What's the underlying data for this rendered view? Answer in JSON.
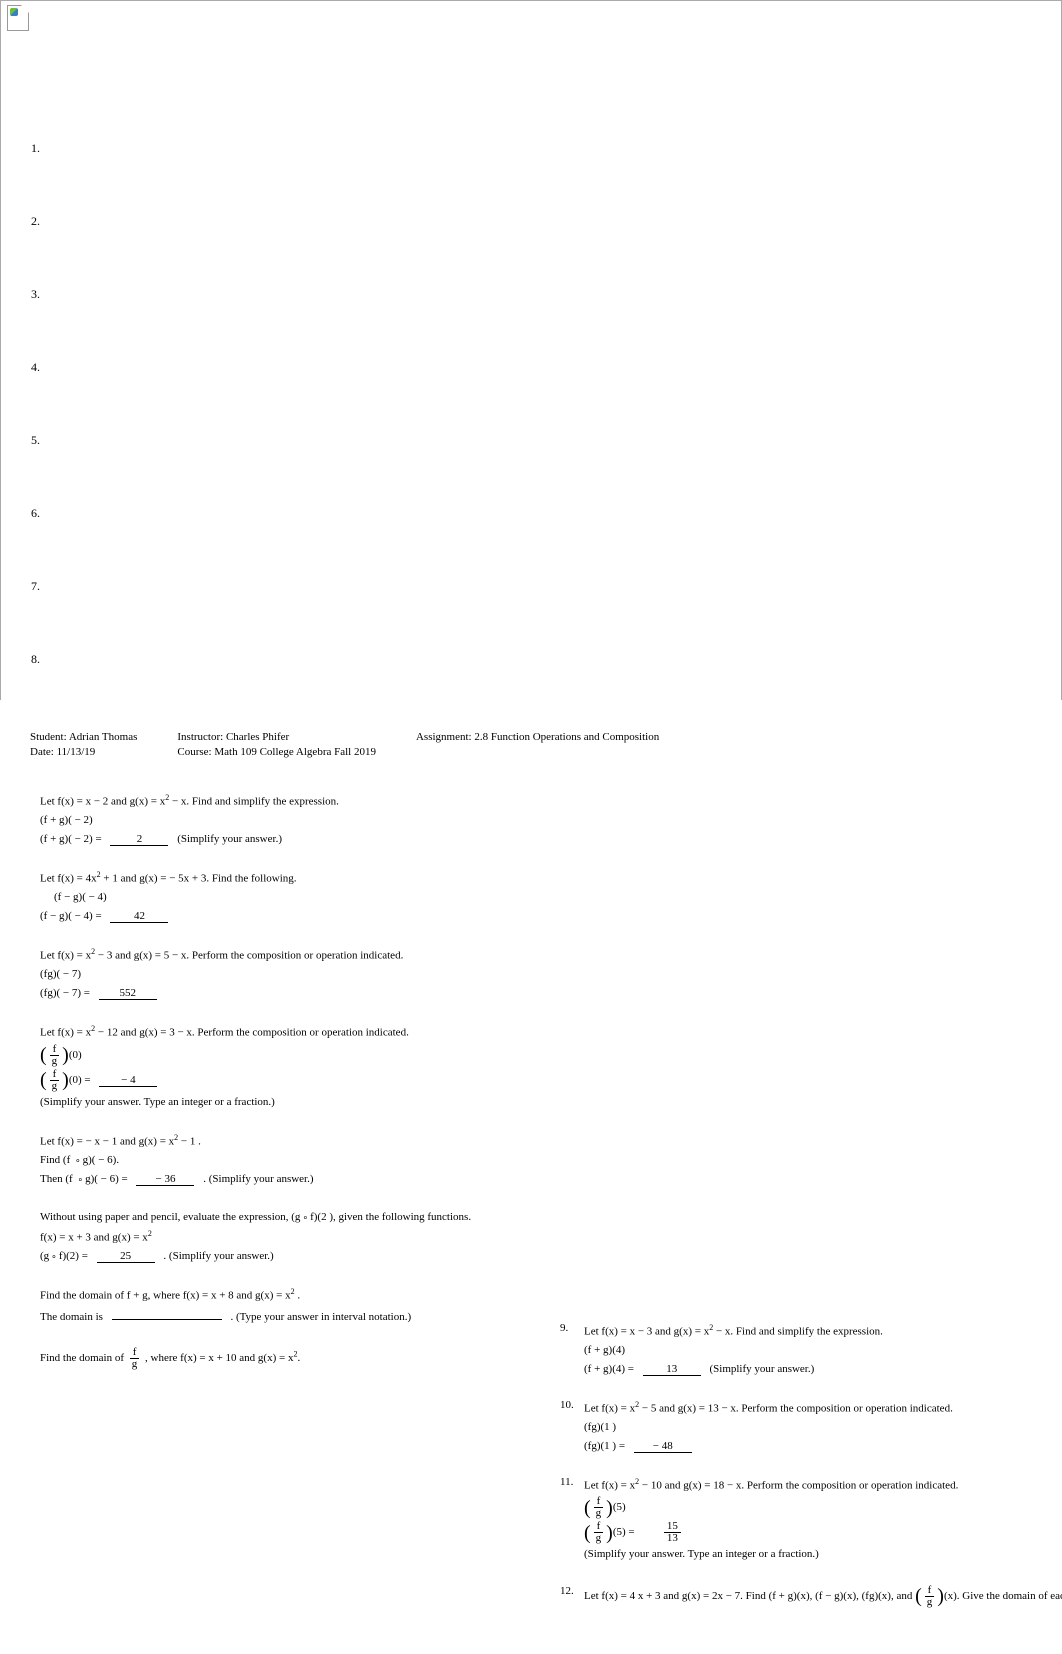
{
  "list_numbers": [
    "1.",
    "2.",
    "3.",
    "4.",
    "5.",
    "6.",
    "7.",
    "8."
  ],
  "header": {
    "student_lbl": "Student:",
    "student_val": "Adrian Thomas",
    "date_lbl": "Date:",
    "date_val": "11/13/19",
    "instructor_lbl": "Instructor:",
    "instructor_val": "Charles Phifer",
    "course_lbl": "Course:",
    "course_val": "Math 109 College Algebra Fall 2019",
    "assignment_lbl": "Assignment:",
    "assignment_val": "2.8 Function Operations and Composition"
  },
  "p1": {
    "l1a": "Let f(x) = x  −  2  and g(x)  = x",
    "l1b": " − x. Find and simplify the expression.",
    "l2": "(f + g)( − 2)",
    "l3a": "(f + g)( − 2) =",
    "ans": "2",
    "l3b": "(Simplify your answer.)"
  },
  "p2": {
    "l1a": "Let f(x) = 4x",
    "l1b": " + 1 and g(x)  =  − 5x + 3. Find the following.",
    "l2": "(f − g)( − 4)",
    "l3a": "(f − g)( − 4) =",
    "ans": "42"
  },
  "p3": {
    "l1a": "Let f(x) = x",
    "l1b": " − 3 and g(x)  = 5 −  x. Perform the composition or operation indicated.",
    "l2": "(fg)( − 7)",
    "l3a": "(fg)( −  7) =",
    "ans": "552"
  },
  "p4": {
    "l1a": "Let f(x) = x",
    "l1b": " − 12  and g(x)  = 3 −  x. Perform the composition or operation indicated.",
    "arg": "(0)",
    "l3a": "(0) =",
    "ans": "− 4",
    "note": "(Simplify your answer. Type an integer or a fraction.)",
    "fn": "f",
    "fd": "g"
  },
  "p5": {
    "l1a": "Let f(x) =  − x − 1 and g(x)  = x",
    "l1b": " −  1 .",
    "l2a": "Find (f ",
    "l2b": "g)( − 6).",
    "l3a": "Then (f ",
    "l3b": "g)( −  6) =",
    "ans": "− 36",
    "l3c": ". (Simplify your answer.)"
  },
  "p6": {
    "l1a": "Without using paper and pencil, evaluate the expression, (g",
    "l1b": "f)(2 ), given the following functions.",
    "l2a": "f(x) = x + 3  and g(x)  = x",
    "l3a": "(g",
    "l3b": "f)(2) =",
    "ans": "25",
    "l3c": ". (Simplify your answer.)"
  },
  "p7": {
    "l1a": "Find the domain of f ",
    "l1b": " + g, where f(x)  = x + 8 and g(x)  = x",
    "l1c": " .",
    "l2a": "The domain is",
    "l2b": ". (Type your answer in interval notation.)"
  },
  "p8": {
    "l1a": "Find the domain of ",
    "l1b": ", where f(x)  = x + 10   and g(x)  = x",
    "l1c": ".",
    "fn": "f",
    "fd": "g"
  },
  "r9": {
    "n": "9.",
    "l1a": "Let f(x) = x  −   3  and g(x) = x",
    "l1b": "  − x. Find and simplify the expression.",
    "l2": "(f + g)(4)",
    "l3a": "(f + g)(4) =",
    "ans": "13",
    "l3b": "(Simplify your answer.)"
  },
  "r10": {
    "n": "10.",
    "l1a": "Let f(x) = x",
    "l1b": " − 5 and g(x)  = 13 −   x. Perform the composition or operation indicated.",
    "l2": "(fg)(1 )",
    "l3a": "(fg)(1 ) =",
    "ans": "− 48"
  },
  "r11": {
    "n": "11.",
    "l1a": "Let f(x) = x",
    "l1b": " − 10  and g(x)  = 18 −  x. Perform the composition or operation indicated.",
    "arg": "(5)",
    "l3a": "(5) =",
    "ansn": "15",
    "ansd": "13",
    "note": "(Simplify your answer. Type an integer or a fraction.)",
    "fn": "f",
    "fd": "g"
  },
  "r12": {
    "n": "12.",
    "l1a": "Let f(x) = 4 x + 3 and g(x)  = 2x − 7. Find (f  + g)(x), (f − g)(x), (fg)(x), and ",
    "l1b": "(x). Give the domain of each.",
    "fn": "f",
    "fd": "g"
  }
}
